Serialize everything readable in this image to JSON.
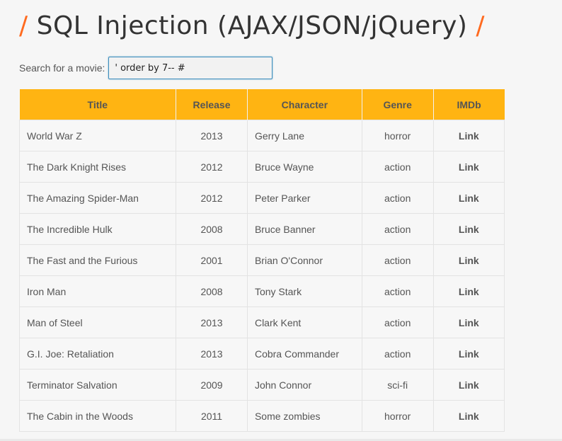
{
  "header": {
    "slash_left": "/",
    "title": "SQL Injection (AJAX/JSON/jQuery)",
    "slash_right": "/"
  },
  "search": {
    "label": "Search for a movie:",
    "value": "' order by 7-- #"
  },
  "table": {
    "columns": [
      "Title",
      "Release",
      "Character",
      "Genre",
      "IMDb"
    ],
    "rows": [
      {
        "title": "World War Z",
        "release": "2013",
        "character": "Gerry Lane",
        "genre": "horror",
        "imdb": "Link"
      },
      {
        "title": "The Dark Knight Rises",
        "release": "2012",
        "character": "Bruce Wayne",
        "genre": "action",
        "imdb": "Link"
      },
      {
        "title": "The Amazing Spider-Man",
        "release": "2012",
        "character": "Peter Parker",
        "genre": "action",
        "imdb": "Link"
      },
      {
        "title": "The Incredible Hulk",
        "release": "2008",
        "character": "Bruce Banner",
        "genre": "action",
        "imdb": "Link"
      },
      {
        "title": "The Fast and the Furious",
        "release": "2001",
        "character": "Brian O'Connor",
        "genre": "action",
        "imdb": "Link"
      },
      {
        "title": "Iron Man",
        "release": "2008",
        "character": "Tony Stark",
        "genre": "action",
        "imdb": "Link"
      },
      {
        "title": "Man of Steel",
        "release": "2013",
        "character": "Clark Kent",
        "genre": "action",
        "imdb": "Link"
      },
      {
        "title": "G.I. Joe: Retaliation",
        "release": "2013",
        "character": "Cobra Commander",
        "genre": "action",
        "imdb": "Link"
      },
      {
        "title": "Terminator Salvation",
        "release": "2009",
        "character": "John Connor",
        "genre": "sci-fi",
        "imdb": "Link"
      },
      {
        "title": "The Cabin in the Woods",
        "release": "2011",
        "character": "Some zombies",
        "genre": "horror",
        "imdb": "Link"
      }
    ]
  },
  "colors": {
    "accent_slash": "#ff6a1f",
    "table_header": "#ffb412"
  }
}
